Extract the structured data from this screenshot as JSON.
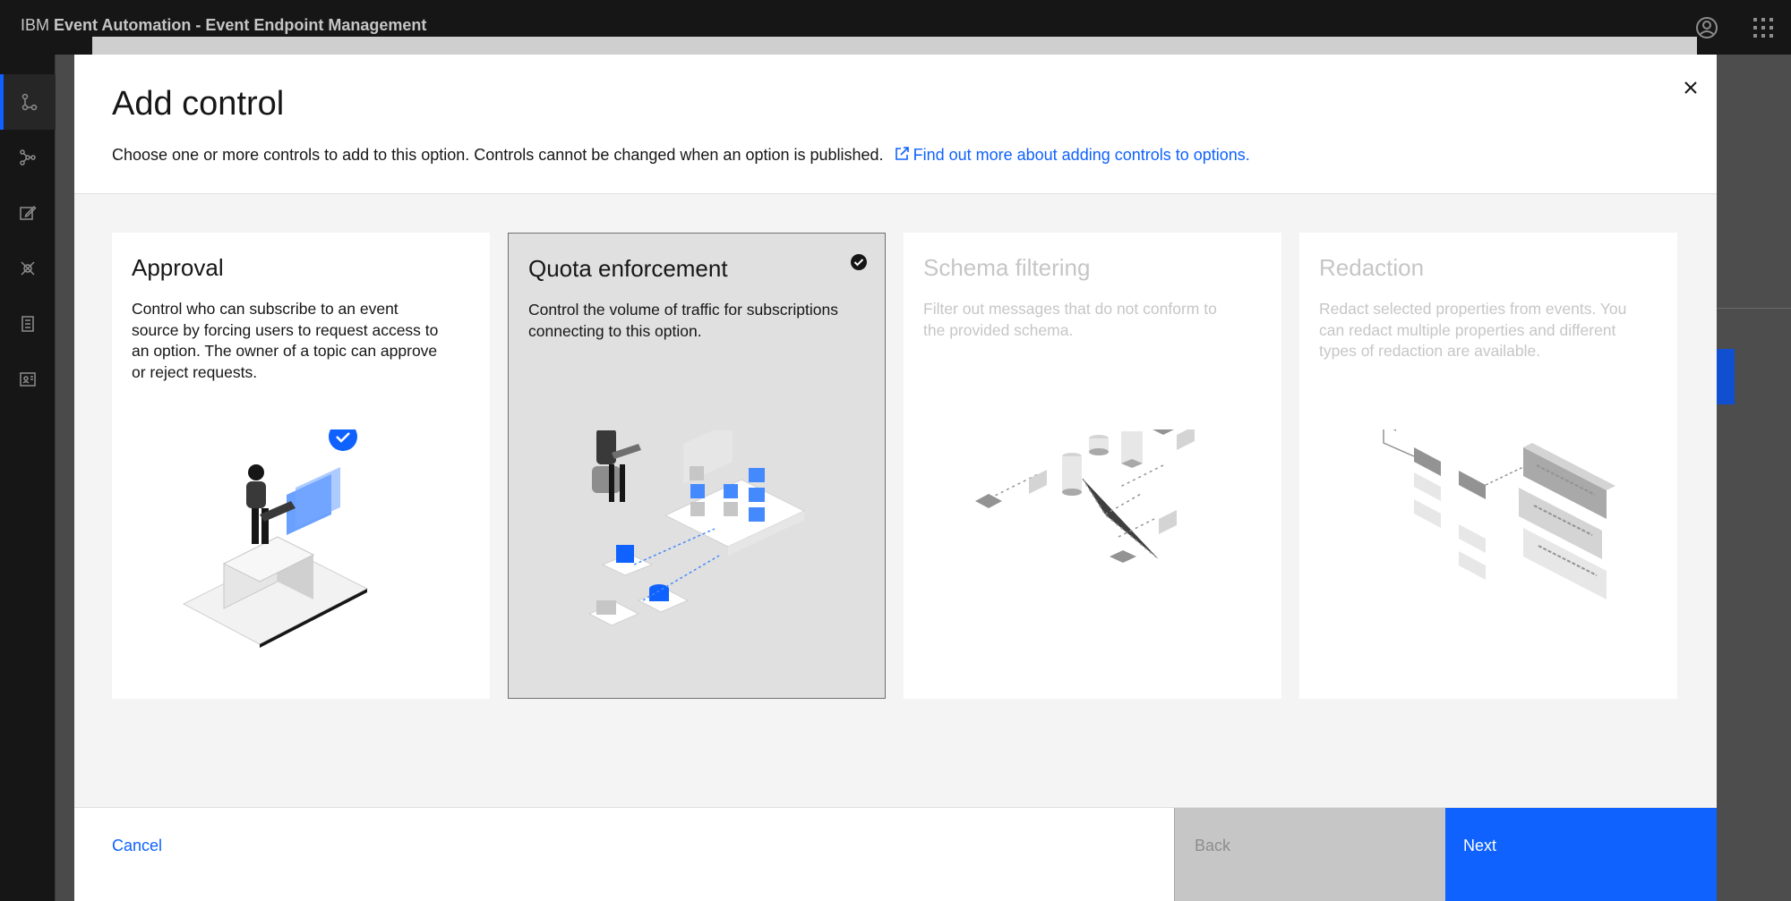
{
  "header": {
    "brand_prefix": "IBM",
    "brand_name": "Event Automation - Event Endpoint Management",
    "user_icon": "user-avatar-icon",
    "apps_icon": "app-switcher-icon"
  },
  "sidenav": {
    "items": [
      {
        "icon": "topology-icon",
        "active": true
      },
      {
        "icon": "network-icon"
      },
      {
        "icon": "edit-icon"
      },
      {
        "icon": "plug-icon"
      },
      {
        "icon": "catalog-icon"
      },
      {
        "icon": "id-badge-icon"
      }
    ]
  },
  "modal": {
    "title": "Add control",
    "description": "Choose one or more controls to add to this option. Controls cannot be changed when an option is published.",
    "link_text": "Find out more about adding controls to options.",
    "cards": [
      {
        "title": "Approval",
        "description": "Control who can subscribe to an event source by forcing users to request access to an option. The owner of a topic can approve or reject requests.",
        "state": "enabled"
      },
      {
        "title": "Quota enforcement",
        "description": "Control the volume of traffic for subscriptions connecting to this option.",
        "state": "selected"
      },
      {
        "title": "Schema filtering",
        "description": "Filter out messages that do not conform to the provided schema.",
        "state": "disabled"
      },
      {
        "title": "Redaction",
        "description": "Redact selected properties from events. You can redact multiple properties and different types of redaction are available.",
        "state": "disabled"
      }
    ],
    "footer": {
      "cancel": "Cancel",
      "back": "Back",
      "next": "Next"
    }
  },
  "colors": {
    "accent": "#0f62fe",
    "header_bg": "#161616",
    "selected_card_bg": "#e0e0e0",
    "disabled_text": "#c6c6c6"
  }
}
